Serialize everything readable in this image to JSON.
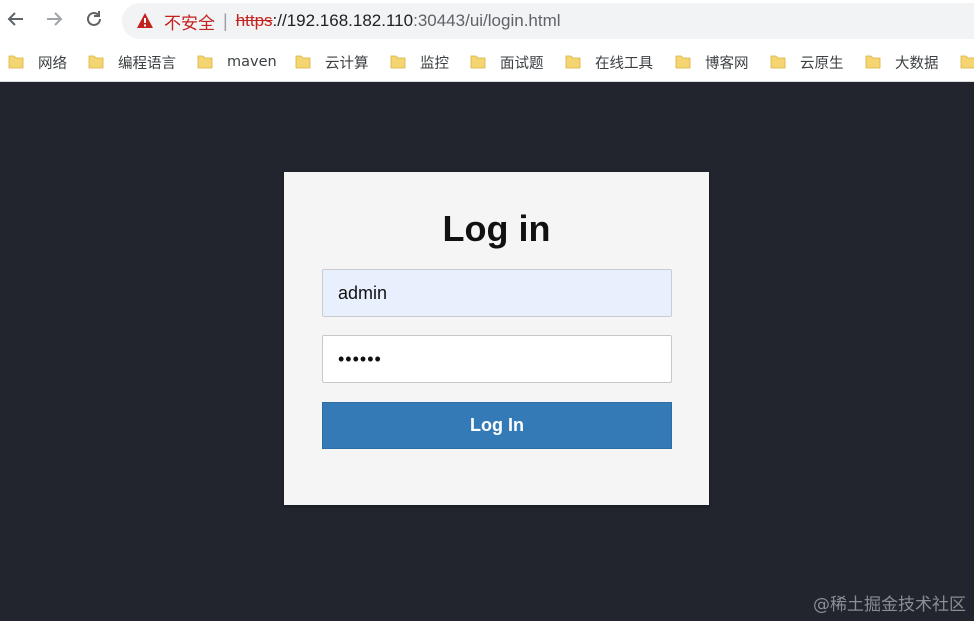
{
  "browser": {
    "security_label": "不安全",
    "separator": "|",
    "url_scheme": "https",
    "url_host": "://192.168.182.110",
    "url_port": ":30443",
    "url_path": "/ui/login.html"
  },
  "bookmarks": [
    {
      "label": "网络"
    },
    {
      "label": "编程语言"
    },
    {
      "label": "maven"
    },
    {
      "label": "云计算"
    },
    {
      "label": "监控"
    },
    {
      "label": "面试题"
    },
    {
      "label": "在线工具"
    },
    {
      "label": "博客网"
    },
    {
      "label": "云原生"
    },
    {
      "label": "大数据"
    }
  ],
  "login": {
    "title": "Log in",
    "username_value": "admin",
    "password_display": "••••••",
    "button_label": "Log In"
  },
  "watermark": "@稀土掘金技术社区",
  "colors": {
    "page_background": "#22252d",
    "button_primary": "#337ab7",
    "autofill_background": "#e8f0fe",
    "insecure_red": "#c5221f"
  }
}
